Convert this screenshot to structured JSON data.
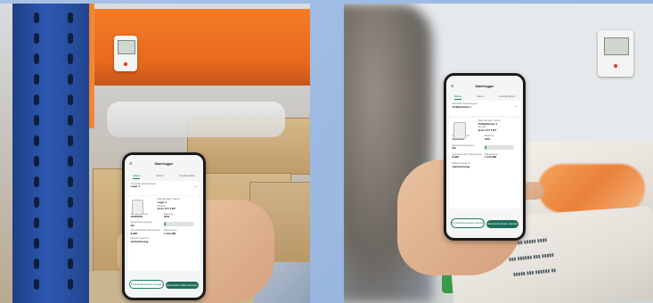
{
  "images": {
    "left": {
      "description_label": ""
    },
    "right": {
      "description_label": ""
    }
  },
  "app_screen": {
    "title": "Datenlogger",
    "tabs": [
      "Status",
      "Daten",
      "Konfiguration"
    ],
    "active_tab": 0,
    "logger_card": {
      "label": "Aktueller Datenlogger",
      "name": "Lager 1"
    },
    "logger_card_right": {
      "label": "Aktueller Datenlogger",
      "name": "Tiefkühltruhe 1"
    },
    "fields": [
      {
        "label": "Datenlogger Name",
        "value": "Lager 1"
      },
      {
        "label": "Modell",
        "value": "testo 174 T BT"
      },
      {
        "label": "Seriennummer",
        "value": "12345678"
      },
      {
        "label": "Batterie",
        "value": "19%"
      },
      {
        "label": "Speicherbelegung",
        "value": "0%"
      },
      {
        "label": "Messintervall",
        "value": "5 min"
      },
      {
        "label": "Speicherplatz Messwerte",
        "value": "8.326"
      },
      {
        "label": "Messwerte",
        "value": "1.444.480"
      },
      {
        "label": "Messprogramm",
        "value": "Aufzeichnung"
      }
    ],
    "battery_level": 0.19,
    "memory_level": 0.05,
    "buttons": {
      "left": "Protokolldownload stoppen",
      "right": "Historische Daten abrufen"
    },
    "status_time": "09:41"
  },
  "colors": {
    "accent": "#1d7a63",
    "rack_blue": "#2d58b1",
    "beam_orange": "#f47c28",
    "battery_green": "#31b24c"
  },
  "icons": [
    "menu-icon",
    "arrow-right-icon",
    "logger-icon"
  ]
}
